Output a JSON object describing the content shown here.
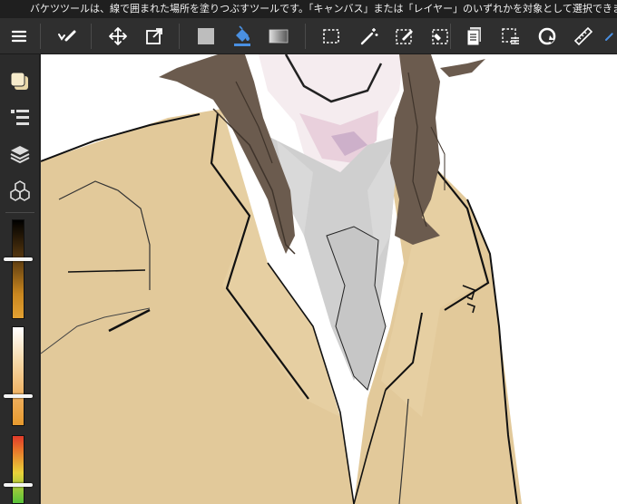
{
  "hint": {
    "text": "バケツツールは、線で囲まれた場所を塗りつぶすツールです。「キャンバス」または「レイヤー」のいずれかを対象として選択できます。"
  },
  "toolbar": {
    "items": [
      {
        "name": "menu-icon"
      },
      {
        "name": "brush-tool-icon"
      },
      {
        "name": "move-tool-icon"
      },
      {
        "name": "transform-tool-icon"
      },
      {
        "name": "fill-color-icon"
      },
      {
        "name": "bucket-tool-icon"
      },
      {
        "name": "gradient-tool-icon"
      },
      {
        "name": "select-rect-icon"
      },
      {
        "name": "magic-wand-icon"
      },
      {
        "name": "select-pen-icon"
      },
      {
        "name": "select-eraser-icon"
      },
      {
        "name": "layer-panel-icon"
      },
      {
        "name": "select-menu-icon"
      },
      {
        "name": "rotate-canvas-icon"
      },
      {
        "name": "ruler-icon"
      }
    ]
  },
  "sidebar": {
    "items": [
      {
        "name": "color-swatch-icon"
      },
      {
        "name": "brush-list-icon"
      },
      {
        "name": "layers-icon"
      },
      {
        "name": "materials-icon"
      }
    ]
  },
  "colors": {
    "chrome": "#2b2b2b",
    "accent_blue": "#4a90e2",
    "coat": "#e2c99a",
    "hair": "#6b5b4e",
    "shirt": "#cccccc"
  },
  "sliders": {
    "brush_size": 0.6,
    "opacity": 0.3,
    "third": 0.28
  }
}
